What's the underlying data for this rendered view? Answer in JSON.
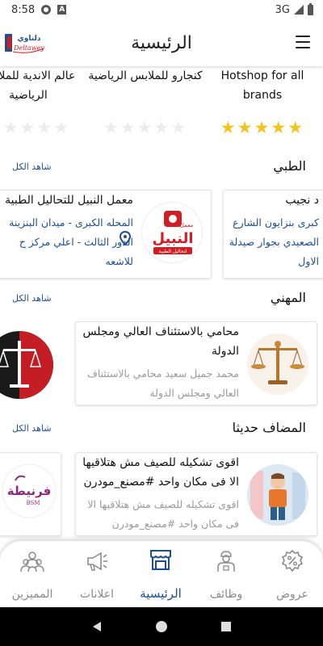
{
  "status": {
    "time": "8:58",
    "network": "3G"
  },
  "app_bar": {
    "title": "الرئيسية",
    "logo_text": "دلتاوي",
    "logo_sub": "Deltawey"
  },
  "brands": [
    {
      "name": "Hotshop for all brands",
      "rating": 5
    },
    {
      "name": "كنجارو للملابس الرياضية",
      "rating": 0
    },
    {
      "name": "عالم الاندية للملابس الرياضية",
      "rating": 0
    }
  ],
  "sections": {
    "medical": {
      "title": "الطبي",
      "see_all": "شاهد الكل"
    },
    "professional": {
      "title": "المهني",
      "see_all": "شاهد الكل"
    },
    "recent": {
      "title": "المضاف حديثا",
      "see_all": "شاهد الكل"
    }
  },
  "medical_cards": [
    {
      "title": "معمل النبيل للتحاليل الطبية",
      "line1": "المحله الكبرى - ميدان البنزينة",
      "line2": "الدور الثالث - اعلي مركز ح",
      "line3": "للاشعه",
      "logo_text": "النبيل",
      "logo_small": "معمل",
      "logo_tag": "لتحاليل الطبية"
    },
    {
      "title": "د نجيب",
      "line1": "كبرى بنزايون الشارع",
      "line2": "الصعيدي بجوار صيدلة",
      "line3": "الاول"
    }
  ],
  "professional_cards": [
    {
      "title1": "محامي بالاستئناف العالي ومجلس",
      "title2": "الدولة",
      "desc1": "محمد جميل سعيد محامي بالاستئناف",
      "desc2": "العالي ومجلس الدولة"
    }
  ],
  "recent_cards": [
    {
      "title1": "اقوى تشكيله للصيف مش هتلاقيها",
      "title2": "الا فى مكان واحد #مصنع_مودرن",
      "desc1": "اقوى تشكيله للصيف مش هتلاقيها الا",
      "desc2": "فى مكان واحد #مصنع_مودرن"
    },
    {
      "logo_text": "فرنيطة",
      "logo_sub": "BSM"
    }
  ],
  "bottom_nav": [
    {
      "label": "عروض",
      "icon": "percent-badge-icon",
      "active": false
    },
    {
      "label": "وظائف",
      "icon": "worker-icon",
      "active": false
    },
    {
      "label": "الرئيسية",
      "icon": "store-icon",
      "active": true
    },
    {
      "label": "اعلانات",
      "icon": "megaphone-icon",
      "active": false
    },
    {
      "label": "المميزين",
      "icon": "team-icon",
      "active": false
    }
  ],
  "colors": {
    "accent": "#1d4f8f",
    "star": "#f6c21c",
    "star_off": "#ececec",
    "logo_red": "#d11d24",
    "legal_dark": "#1a1a1a"
  }
}
